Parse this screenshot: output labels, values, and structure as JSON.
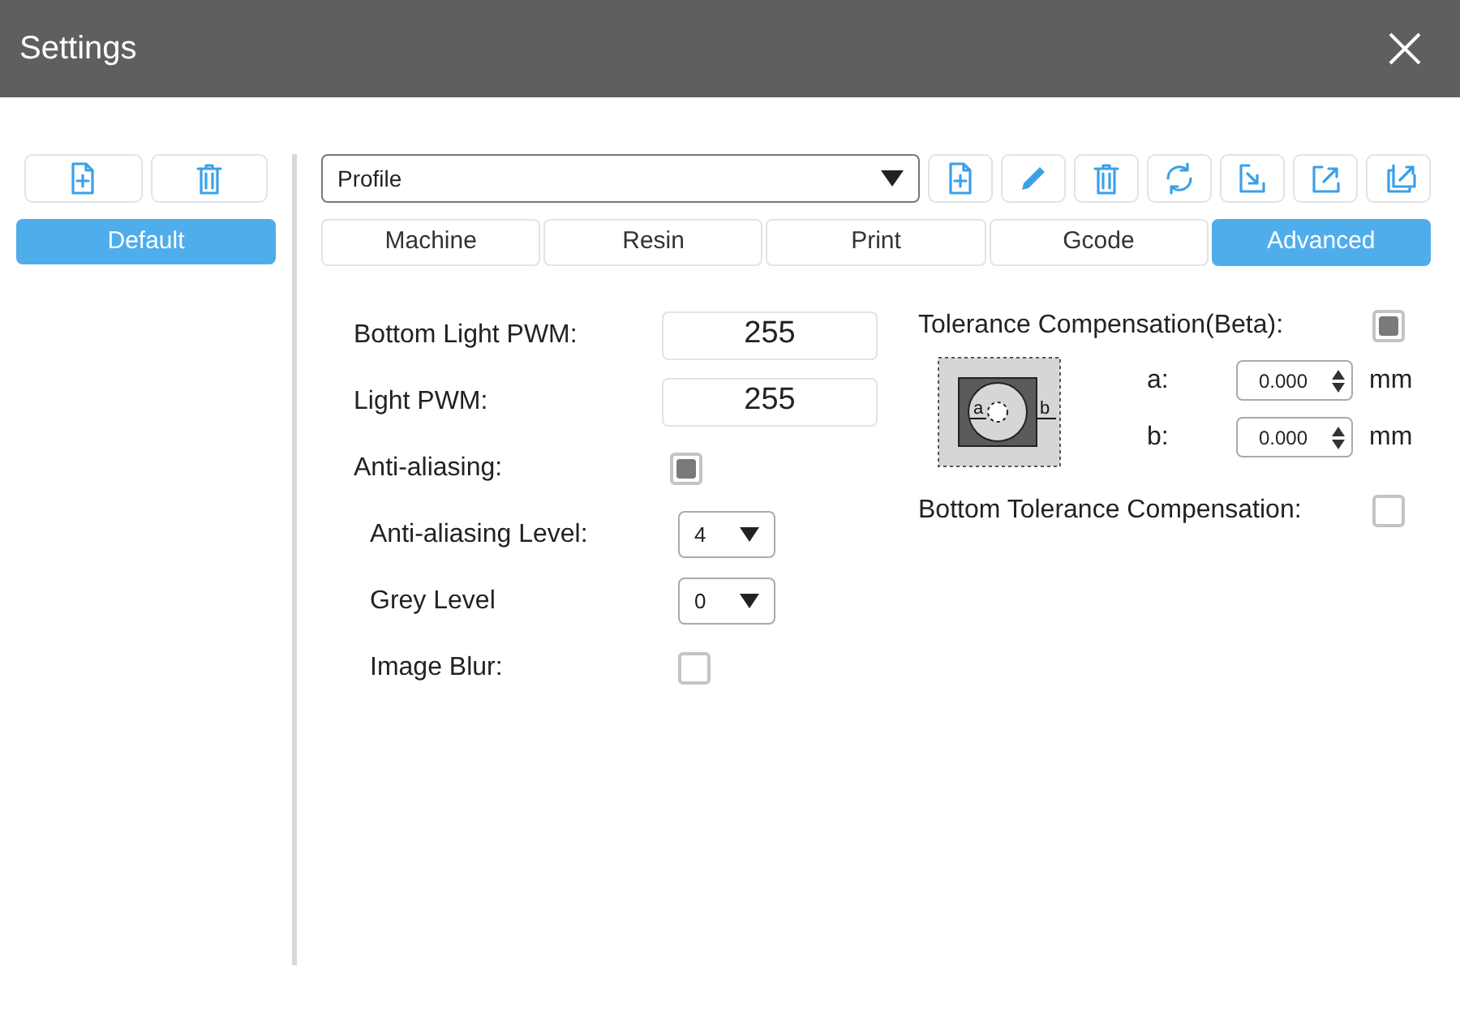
{
  "window": {
    "title": "Settings"
  },
  "profiles": [
    {
      "label": "Default",
      "selected": true
    }
  ],
  "profile_select": {
    "value": "Profile"
  },
  "tabs": [
    {
      "label": "Machine",
      "selected": false
    },
    {
      "label": "Resin",
      "selected": false
    },
    {
      "label": "Print",
      "selected": false
    },
    {
      "label": "Gcode",
      "selected": false
    },
    {
      "label": "Advanced",
      "selected": true
    }
  ],
  "settings": [
    {
      "kind": "input",
      "label": "Bottom Light PWM:",
      "value": "255"
    },
    {
      "kind": "input",
      "label": "Light PWM:",
      "value": "255"
    },
    {
      "kind": "checkbox",
      "label": "Anti-aliasing:",
      "checked": true,
      "children": [
        {
          "kind": "select",
          "label": "Anti-aliasing Level:",
          "value": "4"
        },
        {
          "kind": "select",
          "label": "Grey Level",
          "value": "0"
        },
        {
          "kind": "checkbox",
          "label": "Image Blur:",
          "checked": false
        }
      ]
    }
  ],
  "tolerance": {
    "label": "Tolerance Compensation(Beta):",
    "checked": true,
    "diagram_labels": [
      "a",
      "b"
    ],
    "fields": [
      {
        "label": "a:",
        "value": "0.000",
        "unit": "mm"
      },
      {
        "label": "b:",
        "value": "0.000",
        "unit": "mm"
      }
    ]
  },
  "bottom_tolerance": {
    "label": "Bottom Tolerance Compensation:",
    "checked": false
  }
}
